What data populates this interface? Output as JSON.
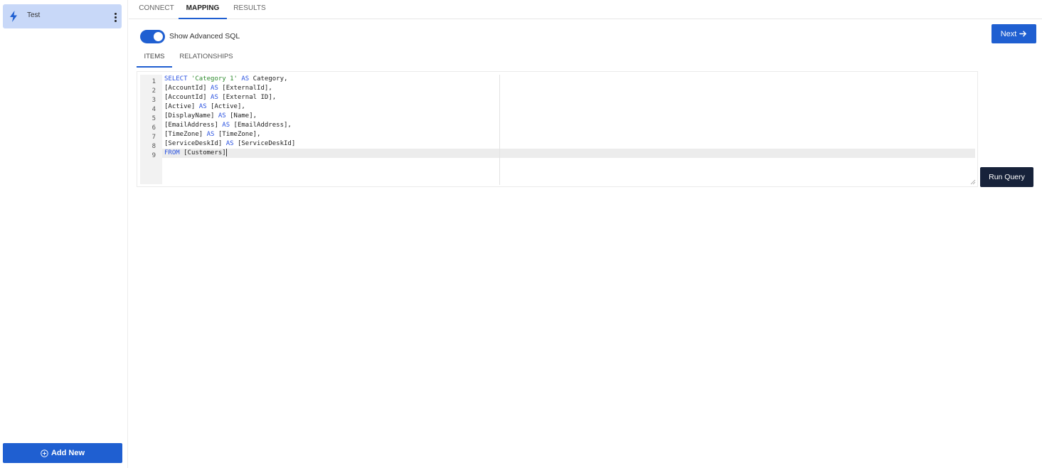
{
  "sidebar": {
    "items": [
      {
        "label": "Test",
        "icon": "bolt-icon"
      }
    ],
    "add_new_label": "Add New"
  },
  "top_tabs": [
    {
      "label": "CONNECT",
      "active": false
    },
    {
      "label": "MAPPING",
      "active": true
    },
    {
      "label": "RESULTS",
      "active": false
    }
  ],
  "advanced_sql": {
    "label": "Show Advanced SQL",
    "enabled": true
  },
  "sub_tabs": [
    {
      "label": "ITEMS",
      "active": true
    },
    {
      "label": "RELATIONSHIPS",
      "active": false
    }
  ],
  "next_label": "Next",
  "run_query_label": "Run Query",
  "editor": {
    "line_numbers": [
      "1",
      "2",
      "3",
      "4",
      "5",
      "6",
      "7",
      "8",
      "9"
    ],
    "active_line": 9,
    "lines": [
      [
        {
          "t": "SELECT ",
          "c": "kw"
        },
        {
          "t": "'Category 1'",
          "c": "str"
        },
        {
          "t": " ",
          "c": ""
        },
        {
          "t": "AS",
          "c": "kw"
        },
        {
          "t": " Category,",
          "c": ""
        }
      ],
      [
        {
          "t": "[AccountId] ",
          "c": ""
        },
        {
          "t": "AS",
          "c": "kw"
        },
        {
          "t": " [ExternalId],",
          "c": ""
        }
      ],
      [
        {
          "t": "[AccountId] ",
          "c": ""
        },
        {
          "t": "AS",
          "c": "kw"
        },
        {
          "t": " [External ID],",
          "c": ""
        }
      ],
      [
        {
          "t": "[Active] ",
          "c": ""
        },
        {
          "t": "AS",
          "c": "kw"
        },
        {
          "t": " [Active],",
          "c": ""
        }
      ],
      [
        {
          "t": "[DisplayName] ",
          "c": ""
        },
        {
          "t": "AS",
          "c": "kw"
        },
        {
          "t": " [Name],",
          "c": ""
        }
      ],
      [
        {
          "t": "[EmailAddress] ",
          "c": ""
        },
        {
          "t": "AS",
          "c": "kw"
        },
        {
          "t": " [EmailAddress],",
          "c": ""
        }
      ],
      [
        {
          "t": "[TimeZone] ",
          "c": ""
        },
        {
          "t": "AS",
          "c": "kw"
        },
        {
          "t": " [TimeZone],",
          "c": ""
        }
      ],
      [
        {
          "t": "[ServiceDeskId] ",
          "c": ""
        },
        {
          "t": "AS",
          "c": "kw"
        },
        {
          "t": " [ServiceDeskId]",
          "c": ""
        }
      ],
      [
        {
          "t": "FROM",
          "c": "kw"
        },
        {
          "t": " [Customers]",
          "c": ""
        }
      ]
    ]
  },
  "colors": {
    "primary": "#1f5fd1",
    "sidebar_active": "#c8d8f8",
    "run_query": "#17223a",
    "keyword": "#2a52e0",
    "string": "#2e8b2e"
  }
}
